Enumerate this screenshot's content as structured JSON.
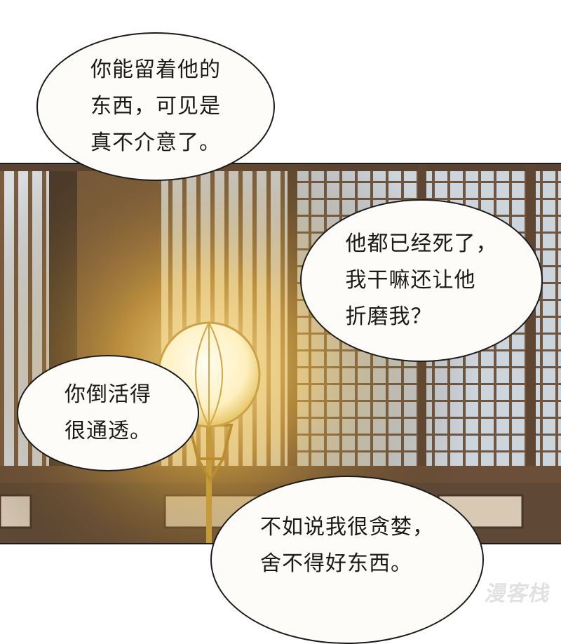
{
  "bubbles": [
    {
      "id": "b1",
      "lines": [
        "你能留着他的",
        "东西，可见是",
        "真不介意了。"
      ]
    },
    {
      "id": "b2",
      "lines": [
        "他都已经死了，",
        "我干嘛还让他",
        "折磨我？"
      ]
    },
    {
      "id": "b3",
      "lines": [
        "你倒活得",
        "很通透。"
      ]
    },
    {
      "id": "b4",
      "lines": [
        "不如说我很贪婪，",
        "舍不得好东西。"
      ]
    }
  ],
  "watermark": "漫客栈",
  "colors": {
    "wood": "#6b4f38",
    "lantern": "#fff3c8",
    "glow": "#f5c24a",
    "paper": "#cfd6de"
  }
}
